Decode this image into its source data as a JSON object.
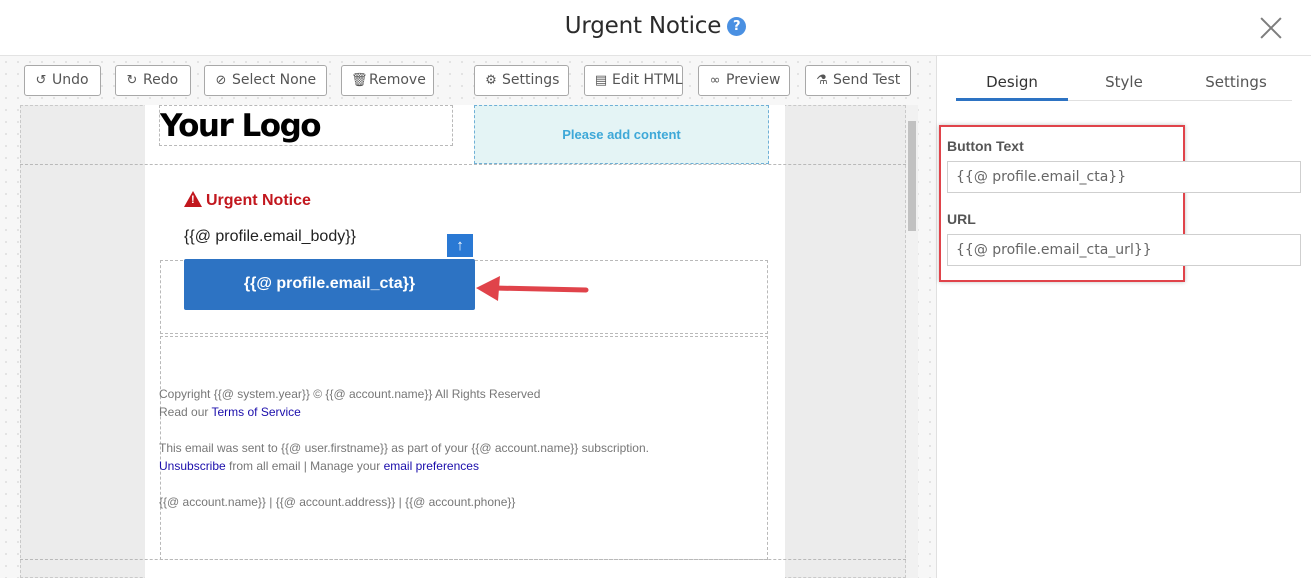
{
  "header": {
    "title": "Urgent Notice",
    "help_glyph": "?"
  },
  "toolbar": {
    "undo": "Undo",
    "redo": "Redo",
    "select_none": "Select None",
    "remove": "Remove",
    "settings": "Settings",
    "edit_html": "Edit HTML",
    "preview": "Preview",
    "send_test": "Send Test"
  },
  "email": {
    "logo": "Your Logo",
    "placeholder": "Please add content",
    "title": "Urgent Notice",
    "body": "{{@ profile.email_body}}",
    "cta": "{{@ profile.email_cta}}",
    "footer": {
      "copyright": "Copyright {{@ system.year}} © {{@ account.name}} All Rights Reserved",
      "read_our": "Read our",
      "terms": "Terms of Service",
      "sent_to": "This email was sent to {{@ user.firstname}} as part of your {{@ account.name}} subscription.",
      "unsubscribe": "Unsubscribe",
      "manage_text": "from all email | Manage your",
      "preferences": "email preferences",
      "account_line": "{{@ account.name}} | {{@ account.address}} | {{@ account.phone}}"
    }
  },
  "panel": {
    "tabs": [
      "Design",
      "Style",
      "Settings"
    ],
    "active_tab": "Design",
    "button_text_label": "Button Text",
    "button_text_value": "{{@ profile.email_cta}}",
    "url_label": "URL",
    "url_value": "{{@ profile.email_cta_url}}"
  },
  "colors": {
    "accent": "#2d73c3",
    "urgent_red": "#c2171e",
    "highlight_red": "#e0434a",
    "placeholder_bg": "#e4f4f5"
  }
}
